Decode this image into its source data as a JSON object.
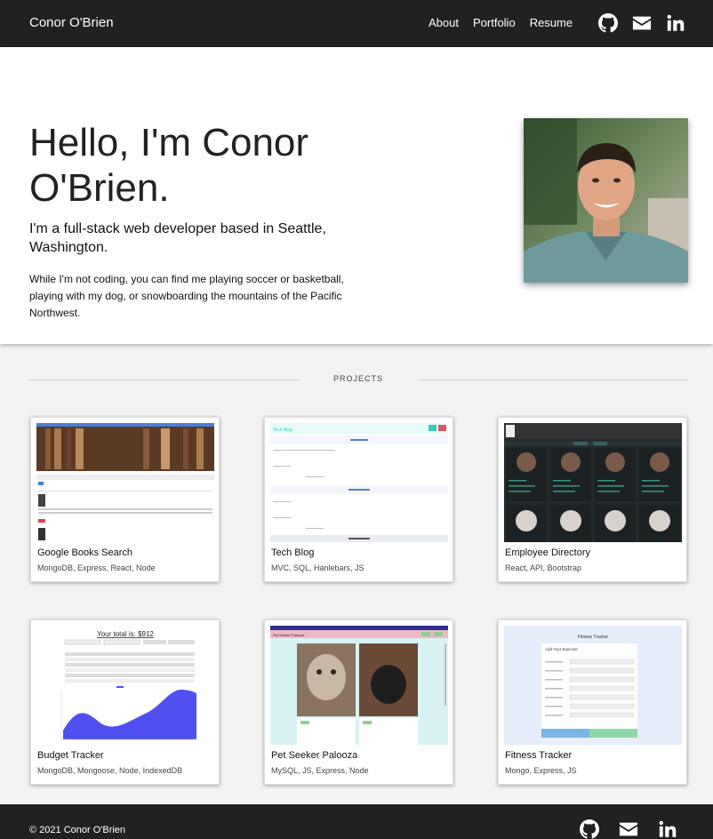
{
  "nav": {
    "brand": "Conor O'Brien",
    "links": [
      "About",
      "Portfolio",
      "Resume"
    ],
    "icons": [
      "github-icon",
      "envelope-icon",
      "linkedin-icon"
    ]
  },
  "hero": {
    "title": "Hello, I'm Conor O'Brien.",
    "subtitle": "I'm a full-stack web developer based in Seattle, Washington.",
    "description": "While I'm not coding, you can find me playing soccer or basketball, playing with my dog, or snowboarding the mountains of the Pacific Northwest."
  },
  "projects": {
    "heading": "PROJECTS",
    "items": [
      {
        "title": "Google Books Search",
        "tech": "MongoDB, Express, React, Node"
      },
      {
        "title": "Tech Blog",
        "tech": "MVC, SQL, Hanlebars, JS"
      },
      {
        "title": "Employee Directory",
        "tech": "React, API, Bootstrap"
      },
      {
        "title": "Budget Tracker",
        "tech": "MongoDB, Mongoose, Node, IndexedDB"
      },
      {
        "title": "Pet Seeker Palooza",
        "tech": "MySQL, JS, Express, Node"
      },
      {
        "title": "Fitness Tracker",
        "tech": "Mongo, Express, JS"
      }
    ],
    "thumb_text": {
      "budget_total": "Your total is: $912",
      "fitness_header": "Fitness Tracker",
      "fitness_form_title": "Add Your Exercise",
      "techblog_brand": "Tech Blog",
      "pet_header": "Pet Seeker Palooza"
    }
  },
  "footer": {
    "copyright": "© 2021 Conor O'Brien",
    "icons": [
      "github-icon",
      "envelope-icon",
      "linkedin-icon"
    ]
  },
  "colors": {
    "navbar": "#212121",
    "accent_teal": "#3ec9b5",
    "budget_chart": "#5050f0"
  }
}
